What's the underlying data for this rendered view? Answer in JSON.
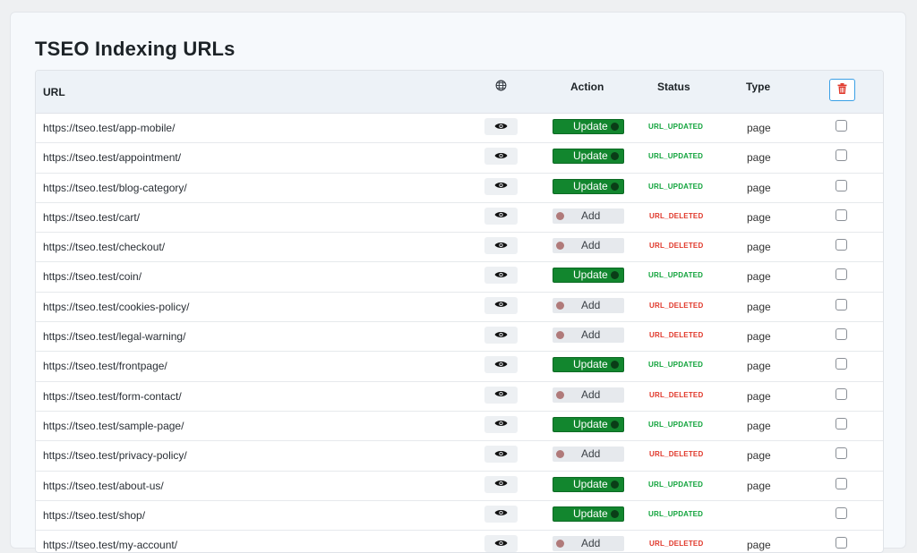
{
  "title": "TSEO Indexing URLs",
  "columns": {
    "url": "URL",
    "globe_icon": "globe-icon",
    "action": "Action",
    "status": "Status",
    "type": "Type",
    "delete_icon": "trash-icon"
  },
  "colors": {
    "updated": "#10a33b",
    "deleted": "#e0382b",
    "toggle_on": "#12862e",
    "delete_border": "#3aa0e6"
  },
  "rows": [
    {
      "url": "https://tseo.test/app-mobile/",
      "action": "Update",
      "action_on": true,
      "status": "URL_UPDATED",
      "type": "page"
    },
    {
      "url": "https://tseo.test/appointment/",
      "action": "Update",
      "action_on": true,
      "status": "URL_UPDATED",
      "type": "page"
    },
    {
      "url": "https://tseo.test/blog-category/",
      "action": "Update",
      "action_on": true,
      "status": "URL_UPDATED",
      "type": "page"
    },
    {
      "url": "https://tseo.test/cart/",
      "action": "Add",
      "action_on": false,
      "status": "URL_DELETED",
      "type": "page"
    },
    {
      "url": "https://tseo.test/checkout/",
      "action": "Add",
      "action_on": false,
      "status": "URL_DELETED",
      "type": "page"
    },
    {
      "url": "https://tseo.test/coin/",
      "action": "Update",
      "action_on": true,
      "status": "URL_UPDATED",
      "type": "page"
    },
    {
      "url": "https://tseo.test/cookies-policy/",
      "action": "Add",
      "action_on": false,
      "status": "URL_DELETED",
      "type": "page"
    },
    {
      "url": "https://tseo.test/legal-warning/",
      "action": "Add",
      "action_on": false,
      "status": "URL_DELETED",
      "type": "page"
    },
    {
      "url": "https://tseo.test/frontpage/",
      "action": "Update",
      "action_on": true,
      "status": "URL_UPDATED",
      "type": "page"
    },
    {
      "url": "https://tseo.test/form-contact/",
      "action": "Add",
      "action_on": false,
      "status": "URL_DELETED",
      "type": "page"
    },
    {
      "url": "https://tseo.test/sample-page/",
      "action": "Update",
      "action_on": true,
      "status": "URL_UPDATED",
      "type": "page"
    },
    {
      "url": "https://tseo.test/privacy-policy/",
      "action": "Add",
      "action_on": false,
      "status": "URL_DELETED",
      "type": "page"
    },
    {
      "url": "https://tseo.test/about-us/",
      "action": "Update",
      "action_on": true,
      "status": "URL_UPDATED",
      "type": "page"
    },
    {
      "url": "https://tseo.test/shop/",
      "action": "Update",
      "action_on": true,
      "status": "URL_UPDATED",
      "type": ""
    },
    {
      "url": "https://tseo.test/my-account/",
      "action": "Add",
      "action_on": false,
      "status": "URL_DELETED",
      "type": "page"
    }
  ]
}
